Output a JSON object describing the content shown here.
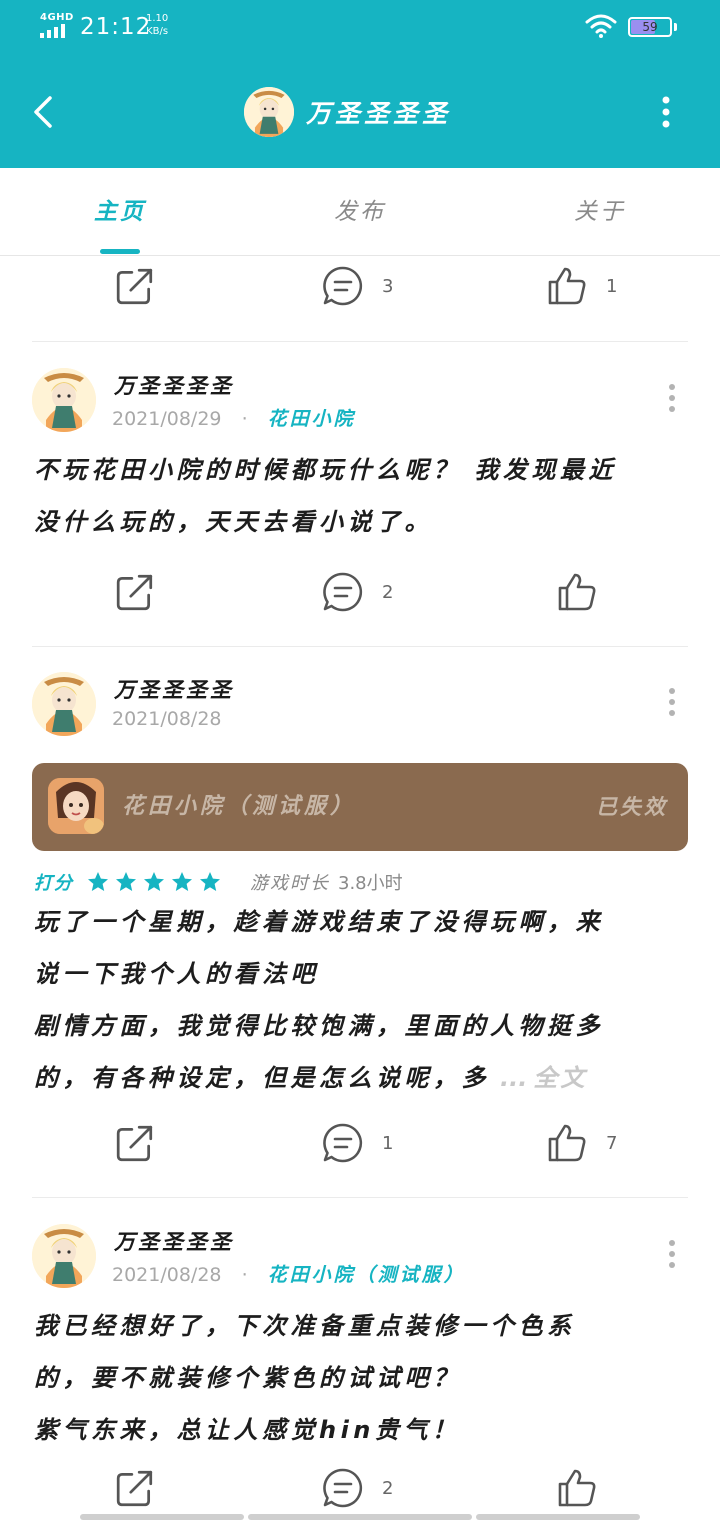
{
  "status_bar": {
    "network": "4GHD",
    "time": "21:12",
    "speed_value": "1.10",
    "speed_unit": "KB/s",
    "battery_level": "59"
  },
  "app_bar": {
    "title": "万圣圣圣圣"
  },
  "tabs": [
    {
      "label": "主页",
      "active": true
    },
    {
      "label": "发布",
      "active": false
    },
    {
      "label": "关于",
      "active": false
    }
  ],
  "top_actions": {
    "comments": "3",
    "likes": "1"
  },
  "posts": [
    {
      "author": "万圣圣圣圣",
      "date": "2021/08/29",
      "separator": "·",
      "tag": "花田小院",
      "lines": [
        "不玩花田小院的时候都玩什么呢？ 我发现最近",
        "没什么玩的，天天去看小说了。"
      ],
      "comments": "2",
      "likes": ""
    },
    {
      "author": "万圣圣圣圣",
      "date": "2021/08/28",
      "game_card": {
        "name": "花田小院（测试服）",
        "status": "已失效"
      },
      "rating_label": "打分",
      "rating": 5,
      "playtime_label": "游戏时长",
      "playtime_value": "3.8小时",
      "lines": [
        "玩了一个星期，趁着游戏结束了没得玩啊，来",
        "说一下我个人的看法吧",
        "剧情方面，我觉得比较饱满，里面的人物挺多",
        "的，有各种设定，但是怎么说呢，多"
      ],
      "ellipsis": "...",
      "more_label": "全文",
      "comments": "1",
      "likes": "7"
    },
    {
      "author": "万圣圣圣圣",
      "date": "2021/08/28",
      "separator": "·",
      "tag": "花田小院（测试服）",
      "lines": [
        "我已经想好了，下次准备重点装修一个色系",
        "的，要不就装修个紫色的试试吧？",
        "紫气东来，总让人感觉hin贵气！"
      ],
      "comments": "2",
      "likes": ""
    }
  ],
  "colors": {
    "accent": "#16b4c2",
    "card": "#8a6a4f",
    "star": "#16b4c2"
  },
  "icons": [
    "back-arrow-icon",
    "more-vertical-icon",
    "share-icon",
    "comment-icon",
    "thumbs-up-icon",
    "star-icon",
    "wifi-icon",
    "signal-icon",
    "battery-icon"
  ]
}
